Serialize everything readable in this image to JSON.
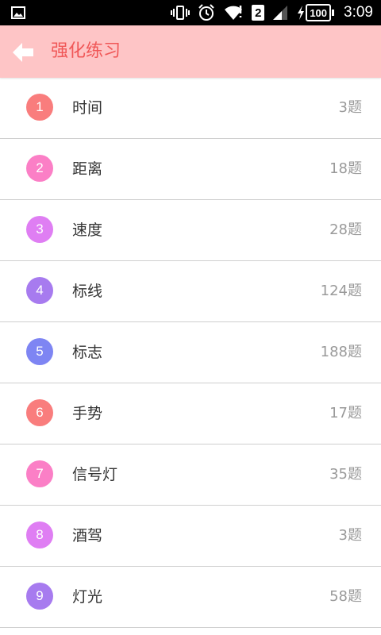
{
  "status_bar": {
    "time": "3:09",
    "battery": "100",
    "sim_slot": "2",
    "icons": [
      "image-icon",
      "vibrate-icon",
      "alarm-icon",
      "wifi-icon",
      "sim-icon",
      "signal-icon",
      "charging-icon",
      "battery-icon"
    ]
  },
  "app_bar": {
    "title": "强化练习",
    "back_icon": "arrow-left-icon",
    "colors": {
      "background": "#fec5c6",
      "title": "#f05757",
      "icon": "#ffffff"
    }
  },
  "list": {
    "items": [
      {
        "number": "1",
        "label": "时间",
        "count": "3题",
        "badge_color": "#f97d7d"
      },
      {
        "number": "2",
        "label": "距离",
        "count": "18题",
        "badge_color": "#fb7fc6"
      },
      {
        "number": "3",
        "label": "速度",
        "count": "28题",
        "badge_color": "#df7ef3"
      },
      {
        "number": "4",
        "label": "标线",
        "count": "124题",
        "badge_color": "#a77bef"
      },
      {
        "number": "5",
        "label": "标志",
        "count": "188题",
        "badge_color": "#7e85f3"
      },
      {
        "number": "6",
        "label": "手势",
        "count": "17题",
        "badge_color": "#f97d7d"
      },
      {
        "number": "7",
        "label": "信号灯",
        "count": "35题",
        "badge_color": "#fb7fc6"
      },
      {
        "number": "8",
        "label": "酒驾",
        "count": "3题",
        "badge_color": "#df7ef3"
      },
      {
        "number": "9",
        "label": "灯光",
        "count": "58题",
        "badge_color": "#a77bef"
      }
    ]
  }
}
